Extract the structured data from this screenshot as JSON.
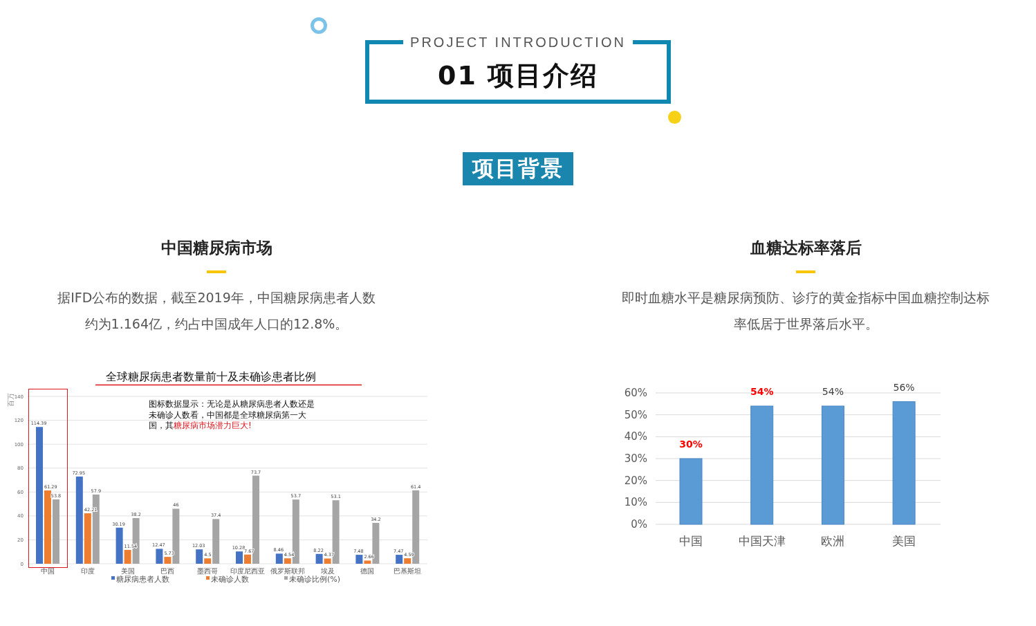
{
  "header": {
    "subtitle": "PROJECT INTRODUCTION",
    "title": "01 项目介绍"
  },
  "section_badge": "项目背景",
  "columns": [
    {
      "heading": "中国糖尿病市场",
      "text": "据IFD公布的数据，截至2019年，中国糖尿病患者人数约为1.164亿，约占中国成年人口的12.8%。",
      "chart_data": {
        "type": "bar",
        "title": "全球糖尿病患者数量前十及未确诊患者比例",
        "ylabel": "百万",
        "categories": [
          "中国",
          "印度",
          "美国",
          "巴西",
          "墨西哥",
          "印度尼西亚",
          "俄罗斯联邦",
          "埃及",
          "德国",
          "巴基斯坦"
        ],
        "series": [
          {
            "name": "糖尿病患者人数",
            "color": "#4472c4",
            "values": [
              114.39,
              72.95,
              30.19,
              12.47,
              12.03,
              10.28,
              8.46,
              8.22,
              7.48,
              7.47
            ]
          },
          {
            "name": "未确诊人数",
            "color": "#ed7d31",
            "values": [
              61.29,
              42.21,
              11.54,
              5.73,
              4.5,
              7.67,
              4.54,
              4.37,
              2.66,
              4.59
            ]
          },
          {
            "name": "未确诊比例(%)",
            "color": "#a5a5a5",
            "values": [
              53.8,
              57.9,
              38.2,
              46,
              37.4,
              73.7,
              53.7,
              53.1,
              34.2,
              61.4
            ]
          }
        ],
        "ylim": [
          0,
          140
        ],
        "yticks": [
          0,
          20,
          40,
          60,
          80,
          100,
          120,
          140
        ],
        "data_labels": true,
        "grid": true,
        "legend": true,
        "annotations": [
          {
            "text": "图标数据显示：无论是从糖尿病患者人数还是未确诊人数看，中国都是全球糖尿病第一大国，其**糖尿病市场潜力巨大!**"
          }
        ]
      }
    },
    {
      "heading": "血糖达标率落后",
      "text": "即时血糖水平是糖尿病预防、诊疗的黄金指标中国血糖控制达标率低居于世界落后水平。",
      "chart_data": {
        "type": "bar",
        "categories": [
          "中国",
          "中国天津",
          "欧洲",
          "美国"
        ],
        "values": [
          30,
          54,
          54,
          56
        ],
        "ylim": [
          0,
          60
        ],
        "grid": true,
        "yticks": [
          {
            "value": 0,
            "label": "0%"
          },
          {
            "value": 10,
            "label": "10%"
          },
          {
            "value": 20,
            "label": "20%"
          },
          {
            "value": 30,
            "label": "30%"
          },
          {
            "value": 40,
            "label": "40%"
          },
          {
            "value": 50,
            "label": "50%"
          },
          {
            "value": 60,
            "label": "60%"
          }
        ],
        "value_labels": [
          {
            "text": "30%",
            "color": "#ff0000"
          },
          {
            "text": "54%",
            "color": "#ff0000"
          },
          {
            "text": "54%",
            "color": "#404040"
          },
          {
            "text": "56%",
            "color": "#404040"
          }
        ]
      }
    }
  ]
}
